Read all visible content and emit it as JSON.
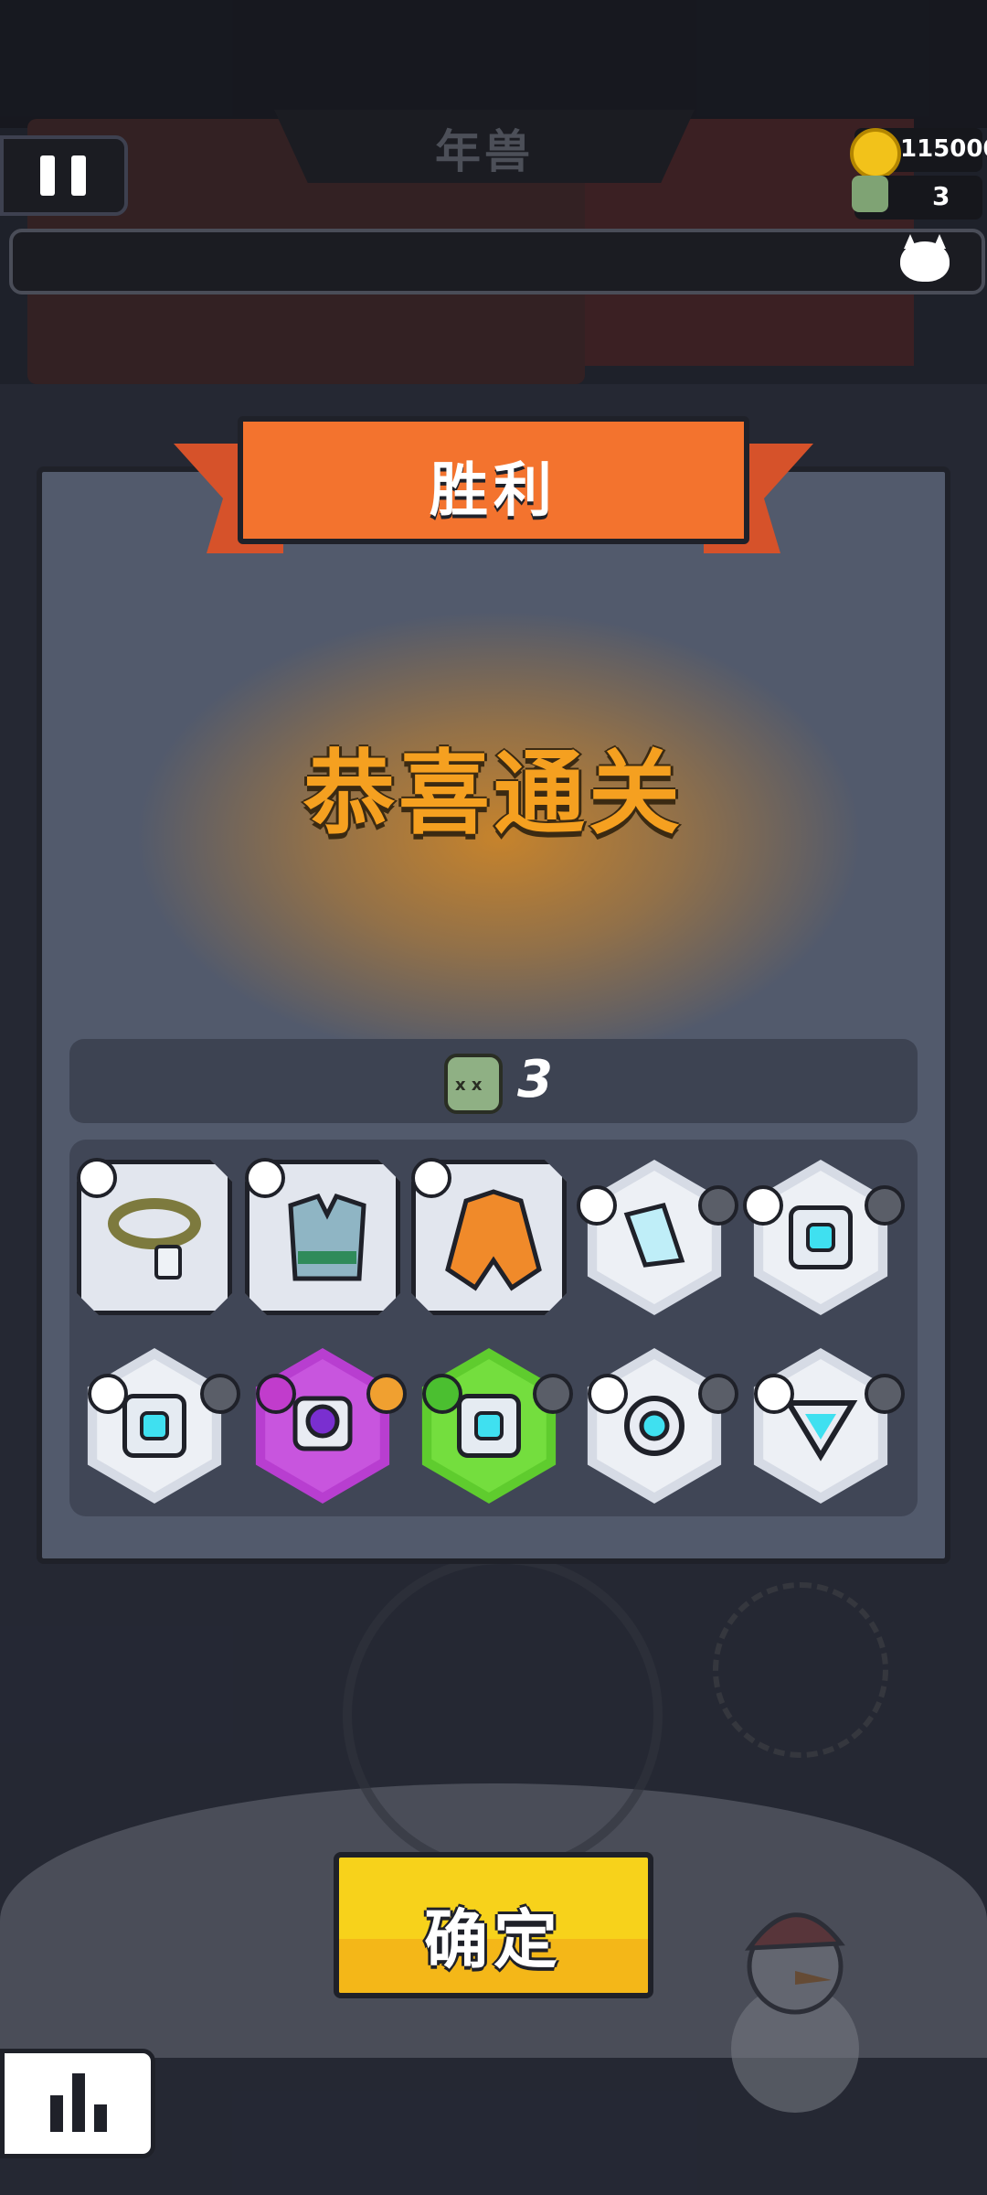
{
  "header": {
    "title": "年兽",
    "coins": "115000",
    "kills": "3"
  },
  "result": {
    "banner": "胜利",
    "message": "恭喜通关",
    "kill_count": "3"
  },
  "rewards": [
    {
      "id": "necklace",
      "frame": "square",
      "badge": "necklace-icon"
    },
    {
      "id": "vest-armor",
      "frame": "square",
      "badge": "shirt-icon"
    },
    {
      "id": "orange-jacket",
      "frame": "square",
      "badge": "shirt-icon"
    },
    {
      "id": "crystal-shard",
      "frame": "hex-silver",
      "badge": "shield-icon"
    },
    {
      "id": "module-cyan",
      "frame": "hex-silver",
      "badge": "shield-icon"
    },
    {
      "id": "module-cyan-2",
      "frame": "hex-silver",
      "badge": "shield-icon"
    },
    {
      "id": "module-purple",
      "frame": "hex-purple",
      "badge": "arrow-icon"
    },
    {
      "id": "module-green",
      "frame": "hex-green",
      "badge": "shield-icon"
    },
    {
      "id": "ring-core",
      "frame": "hex-silver",
      "badge": "arrow-icon"
    },
    {
      "id": "triangle-core",
      "frame": "hex-silver",
      "badge": "arrow-icon"
    }
  ],
  "actions": {
    "confirm": "确定"
  },
  "colors": {
    "ribbon": "#f3732e",
    "congrats": "#f5a020",
    "confirm": "#f7d21b",
    "panel": "#525a6c"
  }
}
